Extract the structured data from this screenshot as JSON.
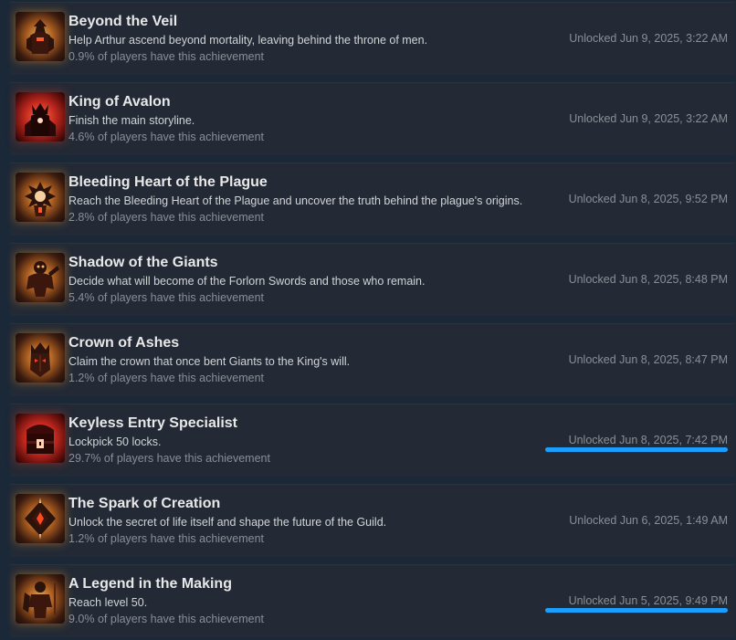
{
  "achievements": [
    {
      "title": "Beyond the Veil",
      "description": "Help Arthur ascend beyond mortality, leaving behind the throne of men.",
      "percent": "0.9% of players have this achievement",
      "unlocked": "Unlocked Jun 9, 2025, 3:22 AM",
      "icon": "veiled-king-icon"
    },
    {
      "title": "King of Avalon",
      "description": "Finish the main storyline.",
      "percent": "4.6% of players have this achievement",
      "unlocked": "Unlocked Jun 9, 2025, 3:22 AM",
      "icon": "crowned-king-icon"
    },
    {
      "title": "Bleeding Heart of the Plague",
      "description": "Reach the Bleeding Heart of the Plague and uncover the truth behind the plague's origins.",
      "percent": "2.8% of players have this achievement",
      "unlocked": "Unlocked Jun 8, 2025, 9:52 PM",
      "icon": "bleeding-heart-icon"
    },
    {
      "title": "Shadow of the Giants",
      "description": "Decide what will become of the Forlorn Swords and those who remain.",
      "percent": "5.4% of players have this achievement",
      "unlocked": "Unlocked Jun 8, 2025, 8:48 PM",
      "icon": "giant-icon"
    },
    {
      "title": "Crown of Ashes",
      "description": "Claim the crown that once bent Giants to the King's will.",
      "percent": "1.2% of players have this achievement",
      "unlocked": "Unlocked Jun 8, 2025, 8:47 PM",
      "icon": "crowned-helm-icon"
    },
    {
      "title": "Keyless Entry Specialist",
      "description": "Lockpick 50 locks.",
      "percent": "29.7% of players have this achievement",
      "unlocked": "Unlocked Jun 8, 2025, 7:42 PM",
      "icon": "lock-chest-icon"
    },
    {
      "title": "The Spark of Creation",
      "description": "Unlock the secret of life itself and shape the future of the Guild.",
      "percent": "1.2% of players have this achievement",
      "unlocked": "Unlocked Jun 6, 2025, 1:49 AM",
      "icon": "spark-diamond-icon"
    },
    {
      "title": "A Legend in the Making",
      "description": "Reach level 50.",
      "percent": "9.0% of players have this achievement",
      "unlocked": "Unlocked Jun 5, 2025, 9:49 PM",
      "icon": "armored-warrior-icon"
    }
  ],
  "highlight_color": "#1a9fff",
  "highlighted_rows": [
    5,
    7
  ]
}
